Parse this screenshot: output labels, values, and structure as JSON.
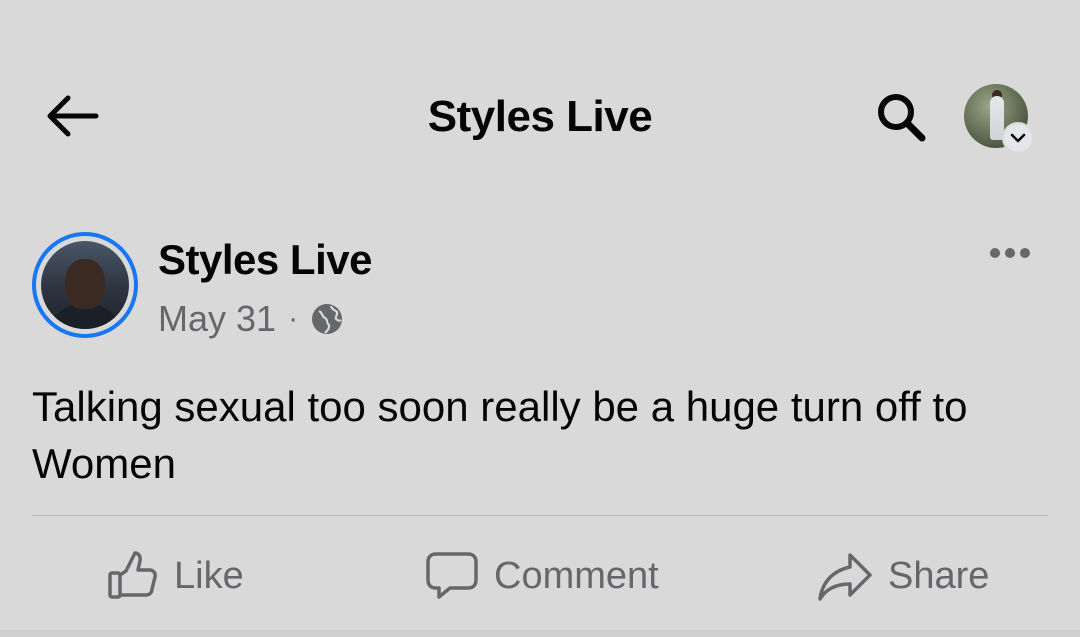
{
  "header": {
    "title": "Styles Live",
    "back_icon": "arrow-left-icon",
    "search_icon": "search-icon",
    "profile_icon": "profile-avatar",
    "dropdown_icon": "chevron-down-icon"
  },
  "post": {
    "author": "Styles Live",
    "date": "May 31",
    "separator": "·",
    "privacy_icon": "globe-icon",
    "more_icon": "more-dots-icon",
    "text": "Talking sexual too soon really be a huge turn off to Women"
  },
  "actions": {
    "like": {
      "label": "Like",
      "icon": "thumbs-up-icon"
    },
    "comment": {
      "label": "Comment",
      "icon": "comment-icon"
    },
    "share": {
      "label": "Share",
      "icon": "share-icon"
    }
  },
  "colors": {
    "background": "#d9d9d9",
    "text_primary": "#050505",
    "text_secondary": "#65676b",
    "avatar_ring": "#1877f2"
  }
}
